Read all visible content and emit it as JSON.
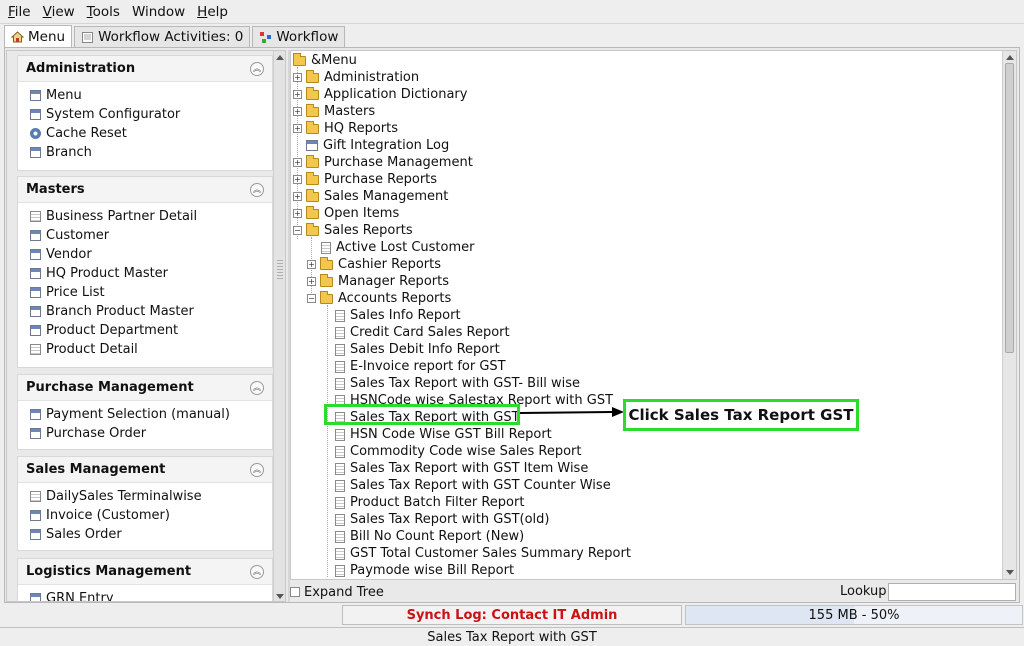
{
  "menubar": {
    "items": [
      {
        "mnemonic": "F",
        "rest": "ile"
      },
      {
        "mnemonic": "V",
        "rest": "iew"
      },
      {
        "mnemonic": "T",
        "rest": "ools"
      },
      {
        "mnemonic": "",
        "rest": "Window"
      },
      {
        "mnemonic": "H",
        "rest": "elp"
      }
    ]
  },
  "tabs": {
    "menu": "Menu",
    "workflow_activities": "Workflow Activities: 0",
    "workflow": "Workflow"
  },
  "groups": {
    "administration": {
      "title": "Administration",
      "items": [
        "Menu",
        "System Configurator",
        "Cache Reset",
        "Branch"
      ]
    },
    "masters": {
      "title": "Masters",
      "items": [
        "Business Partner Detail",
        "Customer",
        "Vendor",
        "HQ Product Master",
        "Price List",
        "Branch Product Master",
        "Product Department",
        "Product Detail"
      ]
    },
    "purchase": {
      "title": "Purchase Management",
      "items": [
        "Payment Selection (manual)",
        "Purchase Order"
      ]
    },
    "sales": {
      "title": "Sales Management",
      "items": [
        "DailySales Terminalwise",
        "Invoice (Customer)",
        "Sales Order"
      ]
    },
    "logistics": {
      "title": "Logistics Management",
      "items": [
        "GRN Entry"
      ]
    }
  },
  "tree": {
    "root": "&Menu",
    "top": [
      "Administration",
      "Application Dictionary",
      "Masters",
      "HQ Reports",
      "Gift Integration Log",
      "Purchase Management",
      "Purchase Reports",
      "Sales Management",
      "Open Items",
      "Sales Reports"
    ],
    "sales_reports_children": [
      "Active Lost Customer",
      "Cashier Reports",
      "Manager Reports",
      "Accounts Reports"
    ],
    "accounts_reports_children": [
      "Sales Info Report",
      "Credit Card Sales Report",
      "Sales Debit Info Report",
      "E-Invoice report for GST",
      "Sales Tax Report with GST- Bill wise",
      "HSNCode wise Salestax Report with GST",
      "Sales Tax Report with GST",
      "HSN Code Wise GST Bill Report",
      "Commodity Code wise Sales Report",
      "Sales Tax Report with GST Item Wise",
      "Sales Tax Report with GST Counter Wise",
      "Product Batch Filter Report",
      "Sales Tax Report with GST(old)",
      "Bill No Count Report (New)",
      "GST Total Customer Sales Summary Report",
      "Paymode wise Bill Report"
    ]
  },
  "annotation": {
    "callout": "Click Sales Tax Report GST"
  },
  "treebar": {
    "expand_tree": "Expand Tree",
    "lookup": "Lookup"
  },
  "status": {
    "synch": "Synch Log: Contact IT Admin",
    "memory": "155 MB - 50%",
    "memory_percent": 50,
    "bottom": "Sales Tax Report with GST"
  },
  "colors": {
    "highlight": "#2bdc2b",
    "synch_text": "#cc1111"
  }
}
